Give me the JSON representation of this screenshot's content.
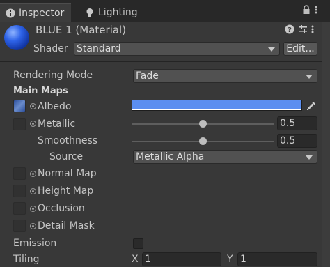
{
  "tabs": [
    {
      "label": "Inspector",
      "icon": "info-icon"
    },
    {
      "label": "Lighting",
      "icon": "lightbulb-icon"
    }
  ],
  "header": {
    "title": "BLUE 1 (Material)",
    "shader_label": "Shader",
    "shader_value": "Standard",
    "edit_button": "Edit..."
  },
  "properties": {
    "rendering_mode_label": "Rendering Mode",
    "rendering_mode_value": "Fade",
    "main_maps": "Main Maps",
    "albedo": "Albedo",
    "albedo_color": "#5b8ef0",
    "metallic": "Metallic",
    "metallic_value": "0.5",
    "smoothness": "Smoothness",
    "smoothness_value": "0.5",
    "source": "Source",
    "source_value": "Metallic Alpha",
    "normal_map": "Normal Map",
    "height_map": "Height Map",
    "occlusion": "Occlusion",
    "detail_mask": "Detail Mask",
    "emission": "Emission",
    "tiling": "Tiling",
    "tiling_x_label": "X",
    "tiling_x": "1",
    "tiling_y_label": "Y",
    "tiling_y": "1"
  },
  "colors": {
    "background": "#383838",
    "tabbar": "#282828",
    "albedo_swatch": "#5b8ef0"
  }
}
